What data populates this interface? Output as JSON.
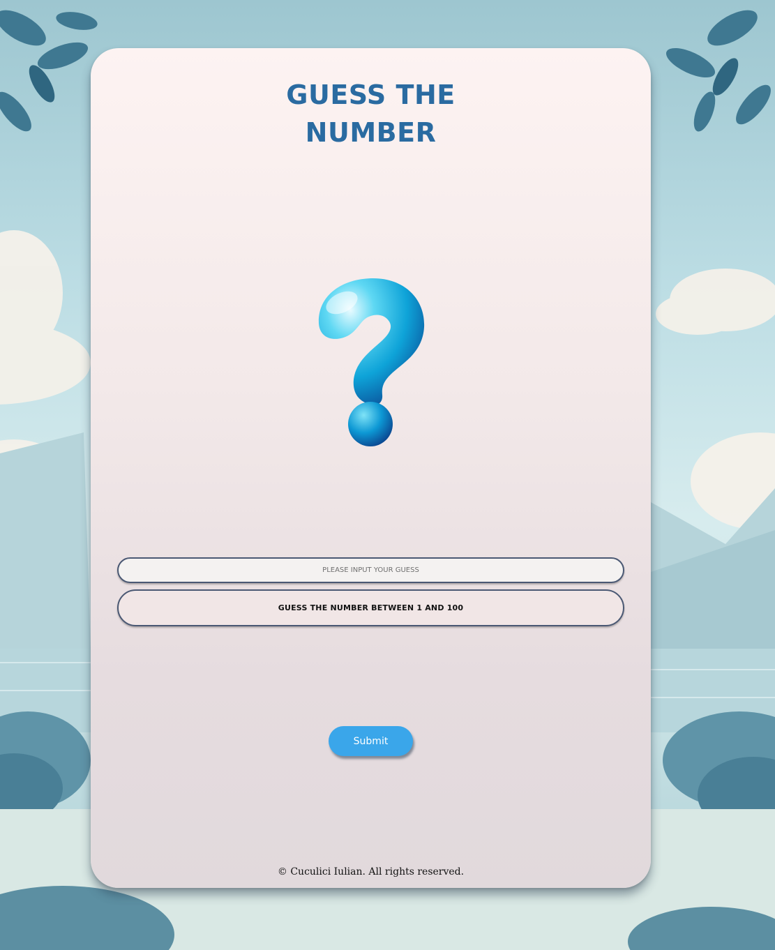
{
  "page": {
    "title": "GUESS THE NUMBER",
    "icon": "question-mark-icon"
  },
  "form": {
    "input_placeholder": "PLEASE INPUT YOUR GUESS",
    "input_value": "",
    "message": "GUESS THE NUMBER BETWEEN 1 AND 100",
    "submit_label": "Submit"
  },
  "footer": {
    "text": "© Cuculici Iulian. All rights reserved."
  },
  "colors": {
    "title": "#2a6ba1",
    "button": "#3aa6ea",
    "card": "#f3e9e9"
  }
}
